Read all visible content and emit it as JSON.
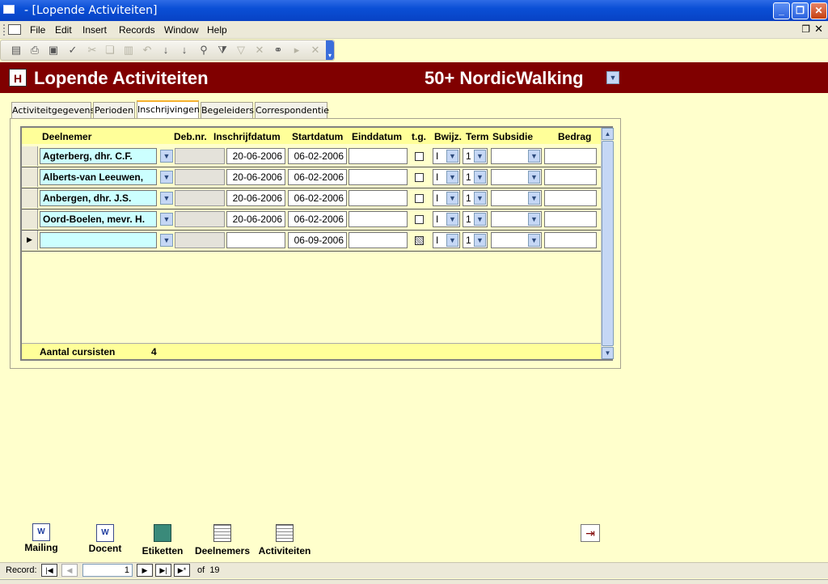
{
  "window": {
    "title": "- [Lopende Activiteiten]"
  },
  "menu": [
    "File",
    "Edit",
    "Insert",
    "Records",
    "Window",
    "Help"
  ],
  "toolbar": {
    "icons": [
      "view-icon",
      "print-icon",
      "save-icon",
      "spellcheck-icon",
      "cut-icon",
      "copy-icon",
      "paste-icon",
      "undo-icon",
      "sort-ascending-icon",
      "sort-descending-icon",
      "filter-by-selection-icon",
      "filter-by-form-icon",
      "apply-filter-icon",
      "delete-icon",
      "find-icon",
      "new-record-icon",
      "delete-record-icon"
    ]
  },
  "header": {
    "icon_letter": "H",
    "form_title": "Lopende Activiteiten",
    "activity": "50+ NordicWalking"
  },
  "tabs": [
    "Activiteitgegevens",
    "Perioden",
    "Inschrijvingen",
    "Begeleiders",
    "Correspondentie"
  ],
  "active_tab": "Inschrijvingen",
  "subform": {
    "columns": [
      "Deelnemer",
      "Deb.nr.",
      "Inschrijfdatum",
      "Startdatum",
      "Einddatum",
      "t.g.",
      "Bwijz.",
      "Term",
      "Subsidie",
      "Bedrag"
    ],
    "rows": [
      {
        "deelnemer": "Agterberg, dhr. C.F.",
        "debnr": "",
        "inschrijfdatum": "20-06-2006",
        "startdatum": "06-02-2006",
        "einddatum": "",
        "tg": false,
        "bwijz": "I",
        "term": "1",
        "subsidie": "",
        "bedrag": ""
      },
      {
        "deelnemer": "Alberts-van Leeuwen,",
        "debnr": "",
        "inschrijfdatum": "20-06-2006",
        "startdatum": "06-02-2006",
        "einddatum": "",
        "tg": false,
        "bwijz": "I",
        "term": "1",
        "subsidie": "",
        "bedrag": ""
      },
      {
        "deelnemer": "Anbergen, dhr. J.S.",
        "debnr": "",
        "inschrijfdatum": "20-06-2006",
        "startdatum": "06-02-2006",
        "einddatum": "",
        "tg": false,
        "bwijz": "I",
        "term": "1",
        "subsidie": "",
        "bedrag": ""
      },
      {
        "deelnemer": "Oord-Boelen, mevr. H.",
        "debnr": "",
        "inschrijfdatum": "20-06-2006",
        "startdatum": "06-02-2006",
        "einddatum": "",
        "tg": false,
        "bwijz": "I",
        "term": "1",
        "subsidie": "",
        "bedrag": ""
      },
      {
        "deelnemer": "",
        "debnr": "",
        "inschrijfdatum": "",
        "startdatum": "06-09-2006",
        "einddatum": "",
        "tg": null,
        "bwijz": "I",
        "term": "1",
        "subsidie": "",
        "bedrag": ""
      }
    ],
    "footer_label": "Aantal cursisten",
    "footer_value": "4"
  },
  "buttons": [
    "Mailing",
    "Docent",
    "Etiketten",
    "Deelnemers",
    "Activiteiten"
  ],
  "recnav": {
    "label": "Record:",
    "current": "1",
    "of_label": "of",
    "total": "19"
  },
  "colors": {
    "header_bg": "#800000",
    "form_bg": "#FFFFCC",
    "name_cell": "#CCFFFF",
    "title_bar": "#0A4FD6"
  }
}
